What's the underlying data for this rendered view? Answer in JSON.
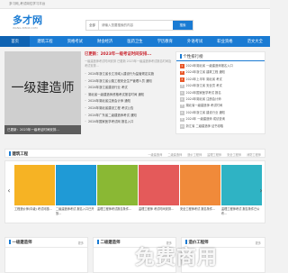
{
  "topbar": {
    "text": "多习网_考试岗位学习平台"
  },
  "header": {
    "logo": "多才网",
    "logo_sub": "WANG.XIBOX.COM"
  },
  "search": {
    "category": "全部",
    "placeholder": "请输入您要搜索的内容",
    "button": "搜索"
  },
  "nav": [
    "首页",
    "建筑工程",
    "资格考试",
    "财会经济",
    "医药卫生",
    "学历教育",
    "外语考试",
    "职业资格",
    "范文大全"
  ],
  "banner": {
    "big_text": "一级建造师",
    "caption": "已更新：2023年一级考证时间安排..."
  },
  "news": {
    "headline": "已更新：2023年一级考证时间安排...",
    "desc": "一级建造师考试时间安排 已更新 2023年一级建造师考试报名时间及考试安排...",
    "items": [
      "2024年浙江省长江流域入建设行为监管规定实施",
      "2024年浙江省公路工程安全生产管理人员 通知",
      "2024年浙江省建设行业 考试",
      "湖北省一级建造师资格考试报名时间 通知",
      "2024年湖北省注册会计师 通知",
      "2024年湖北省建设工程 考试公告",
      "2024年广东省二级建造师考试 通知",
      "2024年国家医学考试网 报名入口"
    ]
  },
  "rank": {
    "title": "个性排行榜",
    "items": [
      "2024年湖北省 一级建造师报名入口",
      "2024年浙江省 建筑工程 通知",
      "2024年上半年 湖北省 考试",
      "2024年浙江省 安全员 考试",
      "2024年国家医学考试 报名",
      "2024年湖北省 注册会计师",
      "湖北省一级建造师 考试时间",
      "2024年浙江省 建设行业 通知",
      "2024年 一级建造师 成绩查询",
      "浙江省 二级建造师 证书领取"
    ]
  },
  "section_building": {
    "title": "建筑工程",
    "tags": [
      "一级建造师",
      "二级建造师",
      "造价工程师",
      "监理工程师",
      "安全工程师",
      "消防工程师"
    ]
  },
  "cards": [
    {
      "caption": "工程造价师(中级) 考试问题...",
      "color": "#f6b324"
    },
    {
      "caption": "二级建造师考试 报名入口已开放...",
      "color": "#1f9ad6"
    },
    {
      "caption": "监理工程师考试报名条件...",
      "color": "#8ab834"
    },
    {
      "caption": "监理工程师 考试时间安排...",
      "color": "#e45a5a"
    },
    {
      "caption": "安全工程师考试 报名条件...",
      "color": "#f08a3a"
    },
    {
      "caption": "监理工程师考试 报名条件已公布...",
      "color": "#2fb3c4"
    }
  ],
  "lower": [
    {
      "title": "一级建造师",
      "more": "更多"
    },
    {
      "title": "二级建造师",
      "more": "更多"
    },
    {
      "title": "造价工程师",
      "more": "更多"
    }
  ],
  "watermark": "免费商用"
}
